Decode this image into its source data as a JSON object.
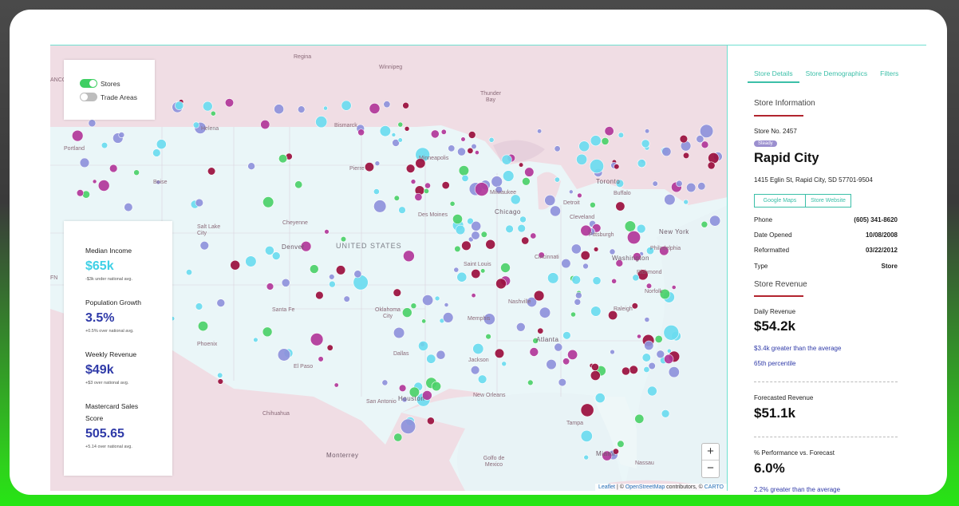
{
  "map": {
    "layers": {
      "stores_label": "Stores",
      "stores_on": true,
      "trade_areas_label": "Trade Areas",
      "trade_areas_on": false
    },
    "country_label": "UNITED STATES",
    "cities": [
      "Regina",
      "Winnipeg",
      "Thunder Bay",
      "Bismarck",
      "Helena",
      "Portland",
      "Boise",
      "Pierre",
      "Minneapolis",
      "Toronto",
      "Buffalo",
      "Milwaukee",
      "Des Moines",
      "Chicago",
      "Detroit",
      "Cleveland",
      "Cheyenne",
      "Salt Lake City",
      "Denver",
      "Pittsburgh",
      "New York",
      "Philadelphia",
      "Saint Louis",
      "Cincinnati",
      "Washington",
      "Richmond",
      "Norfolk",
      "Santa Fe",
      "Nashville",
      "Raleigh",
      "Oklahoma City",
      "Memphis",
      "Phoenix",
      "Atlanta",
      "Dallas",
      "Jackson",
      "El Paso",
      "San Antonio",
      "Houston",
      "New Orleans",
      "Tampa",
      "Chihuahua",
      "Monterrey",
      "Miami",
      "Nassau",
      "Golfo de Mexico"
    ],
    "zoom_in": "+",
    "zoom_out": "−",
    "attribution": {
      "leaflet": "Leaflet",
      "separator": " | © ",
      "osm": "OpenStreetMap",
      "contributors": " contributors, © ",
      "carto": "CARTO"
    },
    "edge_labels": [
      "ANCO",
      "FN"
    ]
  },
  "stats": [
    {
      "label": "Median Income",
      "value": "$65k",
      "note": "-$3k under national avg.",
      "color": "#3fd0e6"
    },
    {
      "label": "Population Growth",
      "value": "3.5%",
      "note": "+0.5% over national avg.",
      "color": "#2f3aa8"
    },
    {
      "label": "Weekly Revenue",
      "value": "$49k",
      "note": "+$3 over national avg.",
      "color": "#2f3aa8"
    },
    {
      "label": "Mastercard Sales Score",
      "value": "505.65",
      "note": "+5.14 over national avg.",
      "color": "#2f3aa8"
    }
  ],
  "panel": {
    "tabs": [
      "Store Details",
      "Store Demographics",
      "Filters"
    ],
    "store_info_title": "Store Information",
    "store_no": "Store No. 2457",
    "badge": "Steady",
    "store_name": "Rapid City",
    "address": "1415 Eglin St, Rapid City, SD 57701-9504",
    "google_maps": "Google Maps",
    "store_website": "Store Website",
    "details": [
      {
        "k": "Phone",
        "v": "(605) 341-8620"
      },
      {
        "k": "Date Opened",
        "v": "10/08/2008"
      },
      {
        "k": "Reformatted",
        "v": "03/22/2012"
      },
      {
        "k": "Type",
        "v": "Store"
      }
    ],
    "revenue_title": "Store Revenue",
    "daily_label": "Daily Revenue",
    "daily_value": "$54.2k",
    "daily_note": "$3.4k greater than the average",
    "daily_pct": "65th percentile",
    "forecast_label": "Forecasted Revenue",
    "forecast_value": "$51.1k",
    "perf_label": "% Performance vs. Forecast",
    "perf_value": "6.0%",
    "perf_note": "2.2% greater than the average"
  },
  "colors": {
    "accent": "#3bbfa8",
    "brand_red": "#b2242e",
    "dot_maroon": "#9b0f3e",
    "dot_magenta": "#b2389a",
    "dot_lavender": "#8f93dc",
    "dot_cyan": "#6cdcf0",
    "dot_green": "#4cd26a"
  }
}
